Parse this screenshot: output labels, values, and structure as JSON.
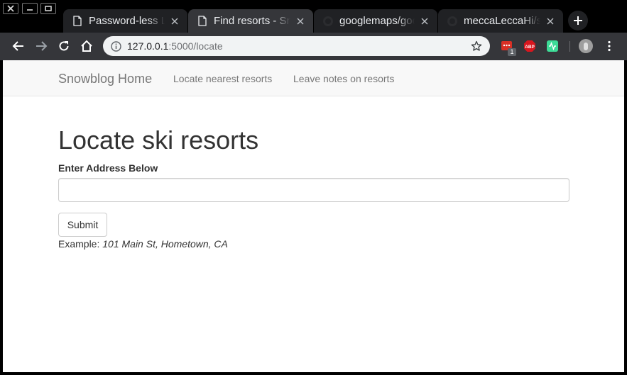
{
  "window_controls": {
    "close_icon": "close-icon",
    "minimize_icon": "minimize-icon",
    "maximize_icon": "maximize-icon"
  },
  "tabs": [
    {
      "title": "Password-less Login",
      "icon": "document-icon",
      "active": false
    },
    {
      "title": "Find resorts - Snowblog",
      "icon": "document-icon",
      "active": true
    },
    {
      "title": "googlemaps/google-maps",
      "icon": "github-icon",
      "active": false
    },
    {
      "title": "meccaLeccaHi/snowblog",
      "icon": "github-icon",
      "active": false
    }
  ],
  "toolbar": {
    "url_host": "127.0.0.1",
    "url_path": ":5000/locate",
    "extension_badge": "1"
  },
  "page": {
    "brand": "Snowblog Home",
    "nav_links": [
      "Locate nearest resorts",
      "Leave notes on resorts"
    ],
    "heading": "Locate ski resorts",
    "field_label": "Enter Address Below",
    "address_value": "",
    "submit_label": "Submit",
    "example_prefix": "Example:",
    "example_value": "101 Main St, Hometown, CA"
  },
  "colors": {
    "chrome_dark": "#202124",
    "chrome_active": "#35363a",
    "navbar_bg": "#f8f8f8",
    "link_gray": "#777777",
    "text": "#333333"
  }
}
